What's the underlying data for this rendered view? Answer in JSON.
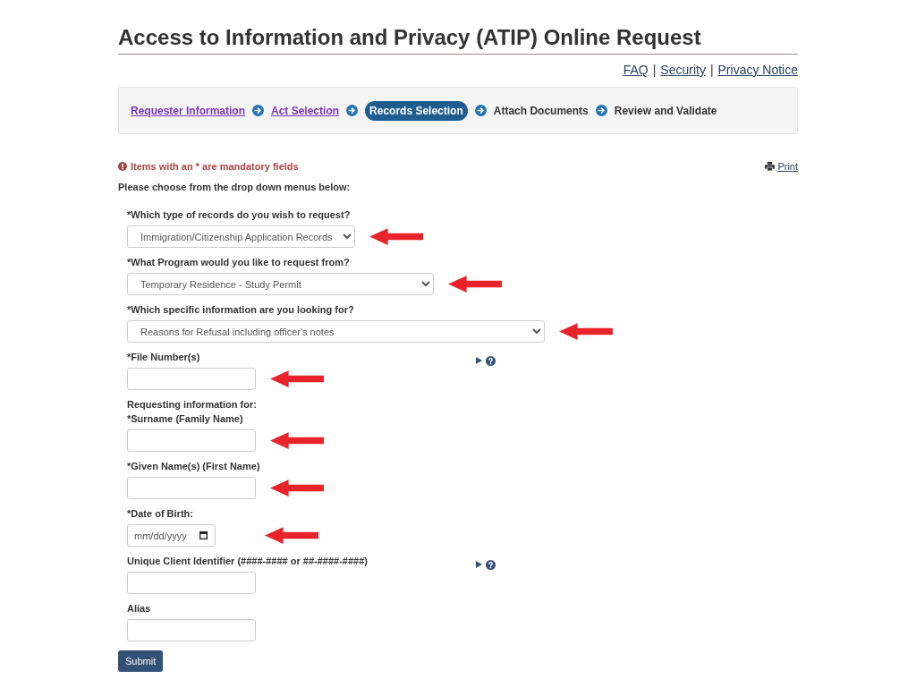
{
  "title": "Access to Information and Privacy (ATIP) Online Request",
  "header_links": [
    {
      "kind": "link",
      "label": "FAQ"
    },
    {
      "kind": "separator",
      "label": "|"
    },
    {
      "kind": "link",
      "label": "Security"
    },
    {
      "kind": "separator",
      "label": "|"
    },
    {
      "kind": "link",
      "label": "Privacy Notice"
    }
  ],
  "steps": [
    {
      "label": "Requester Information",
      "selected": false,
      "completed": true
    },
    {
      "label": "Act Selection",
      "selected": false,
      "completed": true
    },
    {
      "label": "Records Selection",
      "selected": true,
      "completed": false
    },
    {
      "label": "Attach Documents",
      "selected": false,
      "completed": false
    },
    {
      "label": "Review and Validate",
      "selected": false,
      "completed": false
    }
  ],
  "mandatory_notice": "Items with an * are mandatory fields",
  "print_link": "Print",
  "instructions": "Please choose from the drop down menus below:",
  "fields": [
    {
      "kind": "select",
      "label": "*Which type of records do you wish to request?",
      "value": "Immigration/Citizenship Application Records",
      "marked": true
    },
    {
      "kind": "select",
      "label": "*What Program would you like to request from?",
      "value": "Temporary Residence - Study Permit",
      "marked": true
    },
    {
      "kind": "select",
      "label": "*Which specific information are you looking for?",
      "value": "Reasons for Refusal including officer's notes",
      "marked": true
    },
    {
      "kind": "text",
      "label": "*File Number(s)",
      "help": true,
      "marked": true
    },
    {
      "kind": "heading",
      "text": "Requesting information for:"
    },
    {
      "kind": "text",
      "label": "*Surname (Family Name)",
      "help": false,
      "marked": true
    },
    {
      "kind": "text",
      "label": "*Given Name(s) (First Name)",
      "help": false,
      "marked": true
    },
    {
      "kind": "date",
      "label": "*Date of Birth:",
      "placeholder": "mm/dd/yyyy",
      "marked": true
    },
    {
      "kind": "text",
      "label": "Unique Client Identifier (####-#### or ##-####-####)",
      "help": true,
      "marked": false
    },
    {
      "kind": "text",
      "label": "Alias",
      "help": false,
      "marked": false
    }
  ],
  "submit_button": "Submit"
}
